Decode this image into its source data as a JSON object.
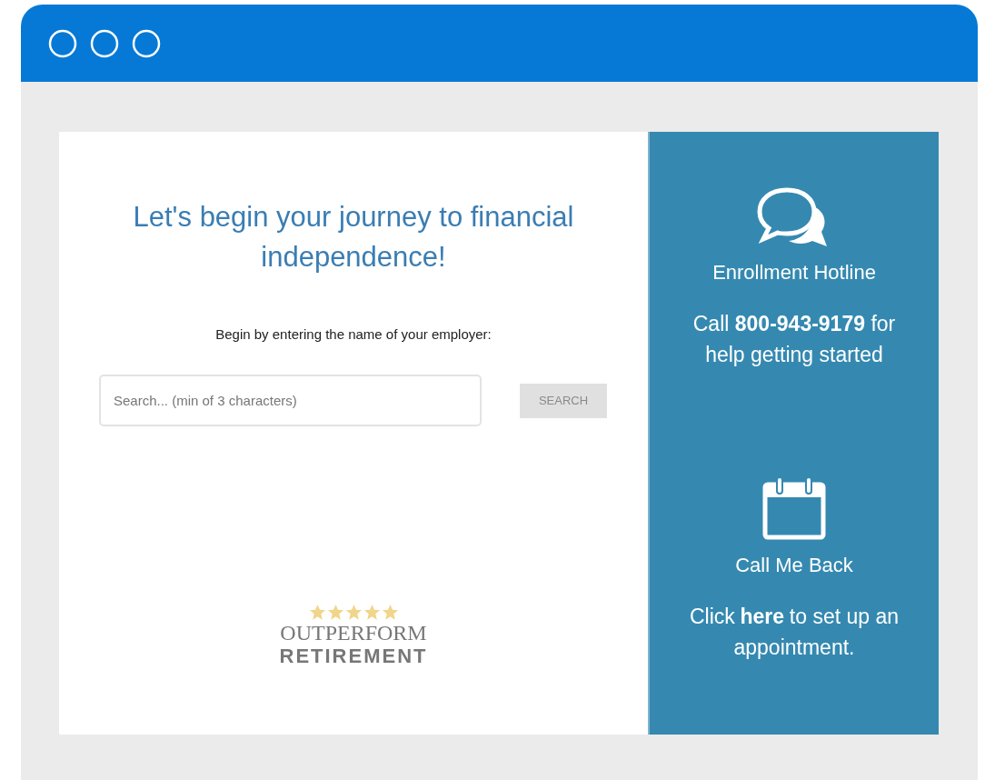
{
  "heading": "Let's begin your journey to financial independence!",
  "prompt": "Begin by entering the name of your employer:",
  "search": {
    "placeholder": "Search... (min of 3 characters)",
    "button": "SEARCH",
    "disabled": true
  },
  "logo": {
    "stars": 5,
    "line_1": "OUTPERFORM",
    "line_2": "RETIREMENT"
  },
  "sidebar": [
    {
      "kind": "chat",
      "title": "Enrollment Hotline",
      "text": "Call **800-943-9179** for help getting started"
    },
    {
      "kind": "calendar",
      "title": "Call Me Back",
      "text_before": "Click",
      "link": "here",
      "text_after": "to set up an appointment."
    }
  ]
}
